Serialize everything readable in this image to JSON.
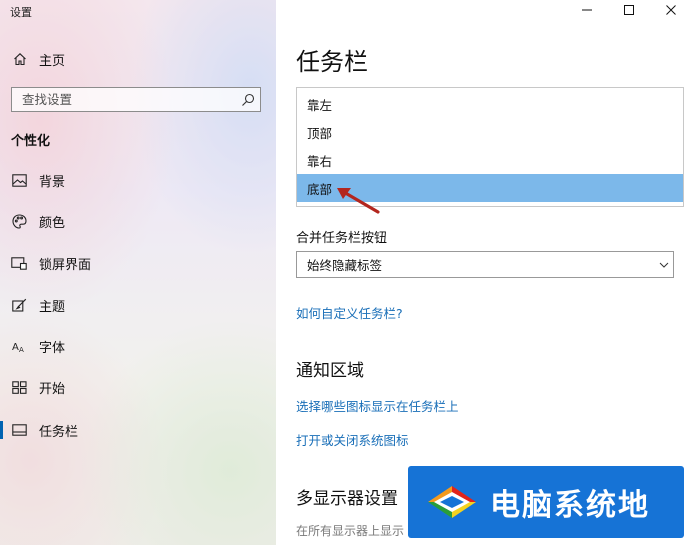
{
  "window": {
    "title": "设置"
  },
  "sidebar": {
    "home": {
      "label": "主页",
      "icon": "home-icon"
    },
    "search": {
      "placeholder": "查找设置",
      "icon": "search-icon"
    },
    "section_title": "个性化",
    "items": [
      {
        "label": "背景",
        "icon": "image-icon",
        "active": false
      },
      {
        "label": "颜色",
        "icon": "palette-icon",
        "active": false
      },
      {
        "label": "锁屏界面",
        "icon": "lock-screen-icon",
        "active": false
      },
      {
        "label": "主题",
        "icon": "theme-brush-icon",
        "active": false
      },
      {
        "label": "字体",
        "icon": "font-icon",
        "active": false
      },
      {
        "label": "开始",
        "icon": "start-menu-icon",
        "active": false
      },
      {
        "label": "任务栏",
        "icon": "taskbar-icon",
        "active": true
      }
    ]
  },
  "main": {
    "page_title": "任务栏",
    "position_options": [
      "靠左",
      "顶部",
      "靠右",
      "底部"
    ],
    "selected_position": "底部",
    "combine_label": "合并任务栏按钮",
    "combine_value": "始终隐藏标签",
    "customize_link": "如何自定义任务栏?",
    "notification_heading": "通知区域",
    "notification_links": [
      "选择哪些图标显示在任务栏上",
      "打开或关闭系统图标"
    ],
    "multi_display_heading": "多显示器设置",
    "multi_display_hint": "在所有显示器上显示"
  },
  "watermark": {
    "text": "电脑系统",
    "last_char": "地"
  },
  "colors": {
    "accent": "#0063b1",
    "link": "#1a6fb8",
    "selected_option": "#7cb8ea",
    "arrow": "#b3261e",
    "watermark_bg": "#1673d6"
  }
}
